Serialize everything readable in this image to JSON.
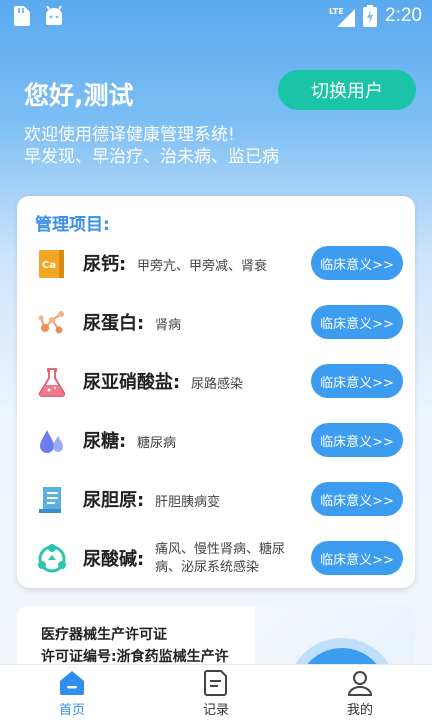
{
  "status_bar": {
    "time": "2:20",
    "network": "LTE"
  },
  "header": {
    "greeting": "您好,测试",
    "switch_user_label": "切换用户",
    "welcome_line1": "欢迎使用德译健康管理系统!",
    "welcome_line2": "早发现、早治疗、治未病、监已病"
  },
  "management": {
    "title": "管理项目:",
    "button_label": "临床意义>>",
    "items": [
      {
        "name": "尿钙:",
        "desc": "甲旁亢、甲旁减、肾衰",
        "icon": "calcium-icon"
      },
      {
        "name": "尿蛋白:",
        "desc": "肾病",
        "icon": "protein-molecule-icon"
      },
      {
        "name": "尿亚硝酸盐:",
        "desc": "尿路感染",
        "icon": "flask-icon"
      },
      {
        "name": "尿糖:",
        "desc": "糖尿病",
        "icon": "drops-icon"
      },
      {
        "name": "尿胆原:",
        "desc": "肝胆胰病变",
        "icon": "document-icon"
      },
      {
        "name": "尿酸碱:",
        "desc": "痛风、慢性肾病、糖尿病、泌尿系统感染",
        "icon": "recycle-icon"
      }
    ]
  },
  "license": {
    "title": "医疗器械生产许可证",
    "number_line": "许可证编号:浙食药监械生产许"
  },
  "nav": {
    "home": "首页",
    "records": "记录",
    "mine": "我的"
  },
  "colors": {
    "accent": "#3b9cf0",
    "switch_button": "#19c5a6",
    "title_blue": "#3a8ee6"
  }
}
